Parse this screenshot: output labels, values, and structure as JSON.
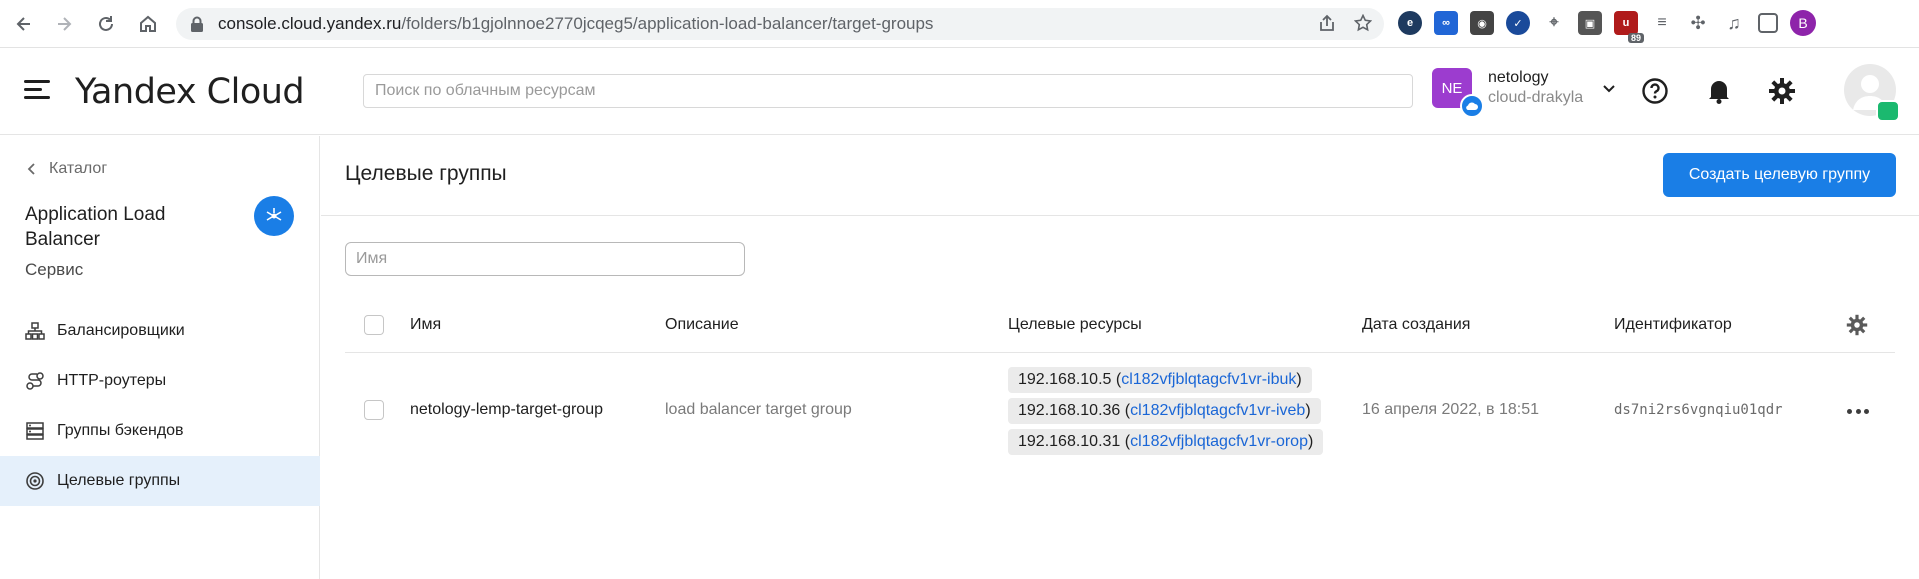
{
  "browser": {
    "url_host": "console.cloud.yandex.ru",
    "url_path": "/folders/b1gjolnnoe2770jcqeg5/application-load-balancer/target-groups",
    "profile_initial": "B",
    "extension_badge": "89"
  },
  "header": {
    "logo": "Yandex Cloud",
    "search_placeholder": "Поиск по облачным ресурсам",
    "org_initials": "NE",
    "org_name": "netology",
    "cloud_name": "cloud-drakyla"
  },
  "sidebar": {
    "back_label": "Каталог",
    "service_title": "Application Load Balancer",
    "service_subtitle": "Сервис",
    "items": [
      {
        "label": "Балансировщики",
        "icon": "balancer-icon"
      },
      {
        "label": "HTTP-роутеры",
        "icon": "router-icon"
      },
      {
        "label": "Группы бэкендов",
        "icon": "backend-groups-icon"
      },
      {
        "label": "Целевые группы",
        "icon": "target-icon",
        "active": true
      }
    ]
  },
  "main": {
    "title": "Целевые группы",
    "create_button": "Создать целевую группу",
    "filter_placeholder": "Имя",
    "columns": [
      "Имя",
      "Описание",
      "Целевые ресурсы",
      "Дата создания",
      "Идентификатор"
    ],
    "rows": [
      {
        "name": "netology-lemp-target-group",
        "description": "load balancer target group",
        "resources": [
          {
            "ip": "192.168.10.5",
            "instance": "cl182vfjblqtagcfv1vr-ibuk"
          },
          {
            "ip": "192.168.10.36",
            "instance": "cl182vfjblqtagcfv1vr-iveb"
          },
          {
            "ip": "192.168.10.31",
            "instance": "cl182vfjblqtagcfv1vr-orop"
          }
        ],
        "created": "16 апреля 2022, в 18:51",
        "id": "ds7ni2rs6vgnqiu01qdr"
      }
    ]
  },
  "colors": {
    "accent": "#1a7ee6",
    "active_nav_bg": "#e5f0fb",
    "link": "#1a66d6",
    "org_avatar": "#9c3ccf"
  }
}
